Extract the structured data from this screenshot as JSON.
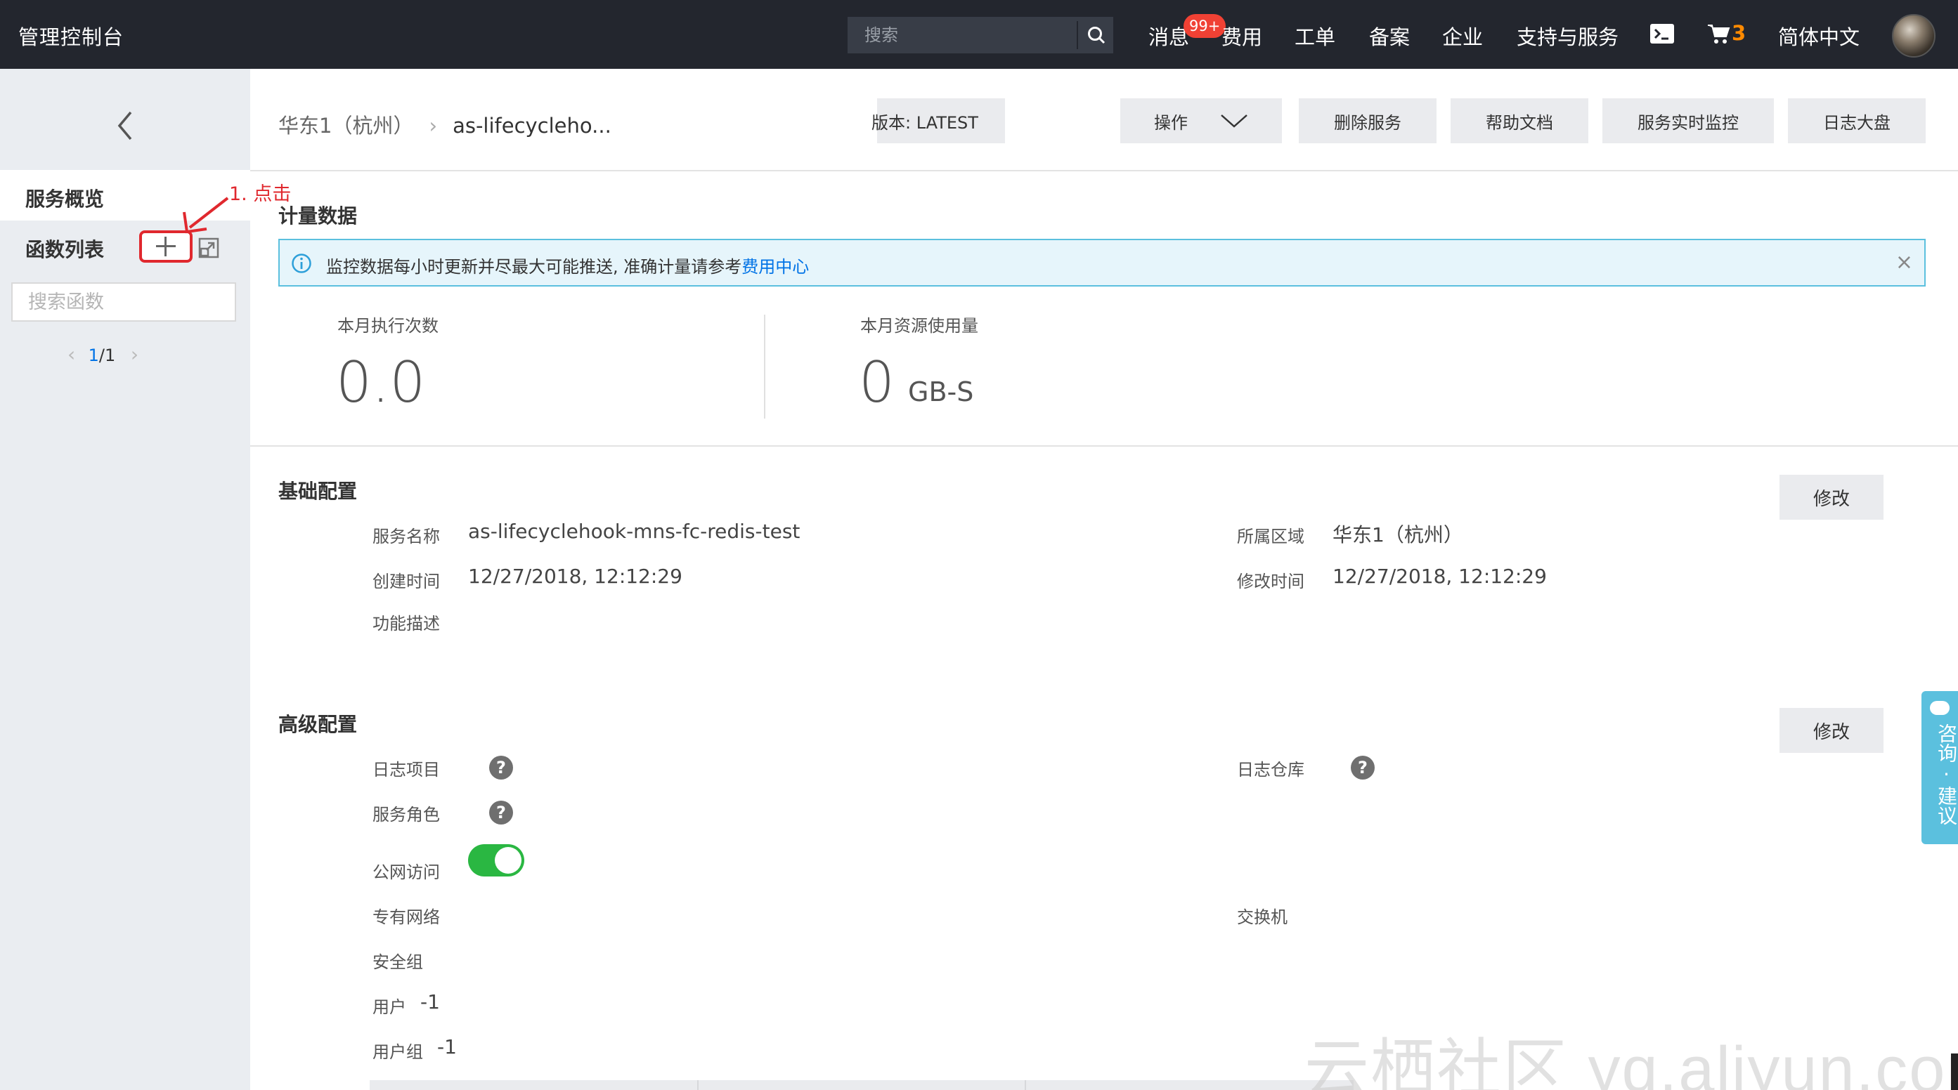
{
  "topbar": {
    "title": "管理控制台",
    "search_placeholder": "搜索",
    "nav": [
      "消息",
      "费用",
      "工单",
      "备案",
      "企业",
      "支持与服务"
    ],
    "message_badge": "99+",
    "cart_count": "3",
    "language": "简体中文",
    "accent_color": "#ff8a00"
  },
  "sidebar": {
    "overview": "服务概览",
    "function_list": "函数列表",
    "search_placeholder": "搜索函数",
    "page_current": "1",
    "page_total": "/1",
    "annotation": "1. 点击"
  },
  "header": {
    "region": "华东1（杭州）",
    "service_short": "as-lifecycleho...",
    "version_btn": "版本: LATEST",
    "ops_btn": "操作",
    "delete_btn": "删除服务",
    "help_btn": "帮助文档",
    "monitor_btn": "服务实时监控",
    "log_btn": "日志大盘"
  },
  "metering": {
    "title": "计量数据",
    "banner_text": "监控数据每小时更新并尽最大可能推送, 准确计量请参考",
    "banner_link": "费用中心",
    "exec_label": "本月执行次数",
    "exec_value": "0.0",
    "res_label": "本月资源使用量",
    "res_value": "0",
    "res_unit": "GB-S"
  },
  "basic": {
    "title": "基础配置",
    "edit": "修改",
    "name_label": "服务名称",
    "name_value": "as-lifecyclehook-mns-fc-redis-test",
    "region_label": "所属区域",
    "region_value": "华东1（杭州）",
    "created_label": "创建时间",
    "created_value": "12/27/2018, 12:12:29",
    "modified_label": "修改时间",
    "modified_value": "12/27/2018, 12:12:29",
    "desc_label": "功能描述"
  },
  "advanced": {
    "title": "高级配置",
    "edit": "修改",
    "log_project_label": "日志项目",
    "log_store_label": "日志仓库",
    "role_label": "服务角色",
    "internet_label": "公网访问",
    "internet_enabled": true,
    "vpc_label": "专有网络",
    "vswitch_label": "交换机",
    "sg_label": "安全组",
    "user_label": "用户",
    "user_value": "-1",
    "group_label": "用户组",
    "group_value": "-1"
  },
  "feedback": {
    "text": "咨询·建议",
    "color": "#5bc0de"
  },
  "watermark": "云栖社区 yq.aliyun.com"
}
